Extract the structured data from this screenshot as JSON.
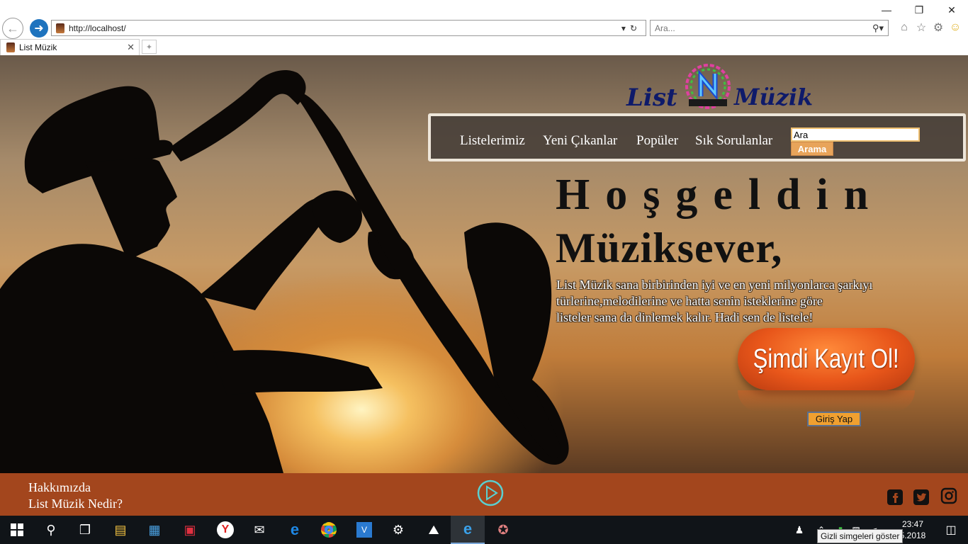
{
  "browser": {
    "url": "http://localhost/",
    "search_placeholder": "Ara...",
    "tab_title": "List Müzik",
    "window_controls": [
      "minimize-icon",
      "restore-icon",
      "close-icon"
    ],
    "toolbar_icons": [
      "home-icon",
      "favorites-star-icon",
      "settings-gear-icon",
      "feedback-smiley-icon"
    ]
  },
  "site": {
    "logo_left": "List",
    "logo_right": "Müzik",
    "nav": [
      "Listelerimiz",
      "Yeni Çıkanlar",
      "Popüler",
      "Sık Sorulanlar"
    ],
    "search_value": "Ara",
    "search_button": "Arama",
    "welcome_line1": "Hoşgeldin",
    "welcome_line2": "Müziksever,",
    "intro_lines": [
      "List Müzik sana birbirinden iyi ve en yeni milyonlarca şarkıyı",
      "türlerine,melodilerine ve hatta senin isteklerine göre",
      "listeler sana da dinlemek kalır. Hadi sen de listele!"
    ],
    "cta": "Şimdi Kayıt Ol!",
    "login": "Giriş Yap",
    "footer_links": [
      "Hakkımızda",
      "List Müzik Nedir?"
    ],
    "social_icons": [
      "facebook-icon",
      "twitter-icon",
      "instagram-icon"
    ],
    "colors": {
      "footer": "#a3461d",
      "cta": "#e8561a",
      "nav_bg": "#463e38",
      "login_btn": "#f0a030"
    }
  },
  "taskbar": {
    "apps": [
      "start-icon",
      "search-icon",
      "task-view-icon",
      "file-explorer-icon",
      "store-icon",
      "gift-icon",
      "yandex-icon",
      "mail-icon",
      "edge-icon",
      "chrome-icon",
      "visual-studio-code-icon",
      "settings-icon",
      "photos-icon",
      "internet-explorer-icon",
      "paint-icon"
    ],
    "time": "23:47",
    "date_fragment": "5.2018",
    "tooltip": "Gizli simgeleri göster"
  }
}
